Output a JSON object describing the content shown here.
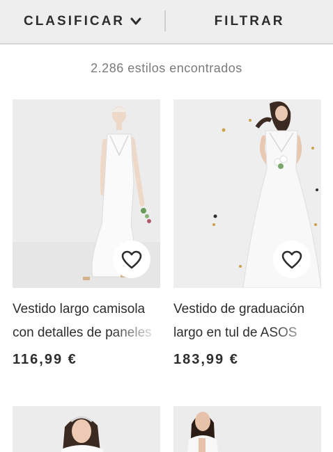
{
  "toolbar": {
    "sort_label": "CLASIFICAR",
    "filter_label": "FILTRAR"
  },
  "results": {
    "count_text": "2.286 estilos encontrados"
  },
  "products": [
    {
      "name_line1": "Vestido largo camisola",
      "name_line2": "con detalles de paneles",
      "price": "116,99 €"
    },
    {
      "name_line1": "Vestido de graduación",
      "name_line2": "largo en tul de ASOS",
      "price": "183,99 €"
    }
  ],
  "icons": {
    "sort": "chevron-down-icon",
    "favorite": "heart-outline-icon"
  },
  "colors": {
    "topbar_bg": "#eeeeee",
    "text": "#2d2d2d",
    "muted": "#7a7a7a",
    "image_bg": "#ececec"
  }
}
